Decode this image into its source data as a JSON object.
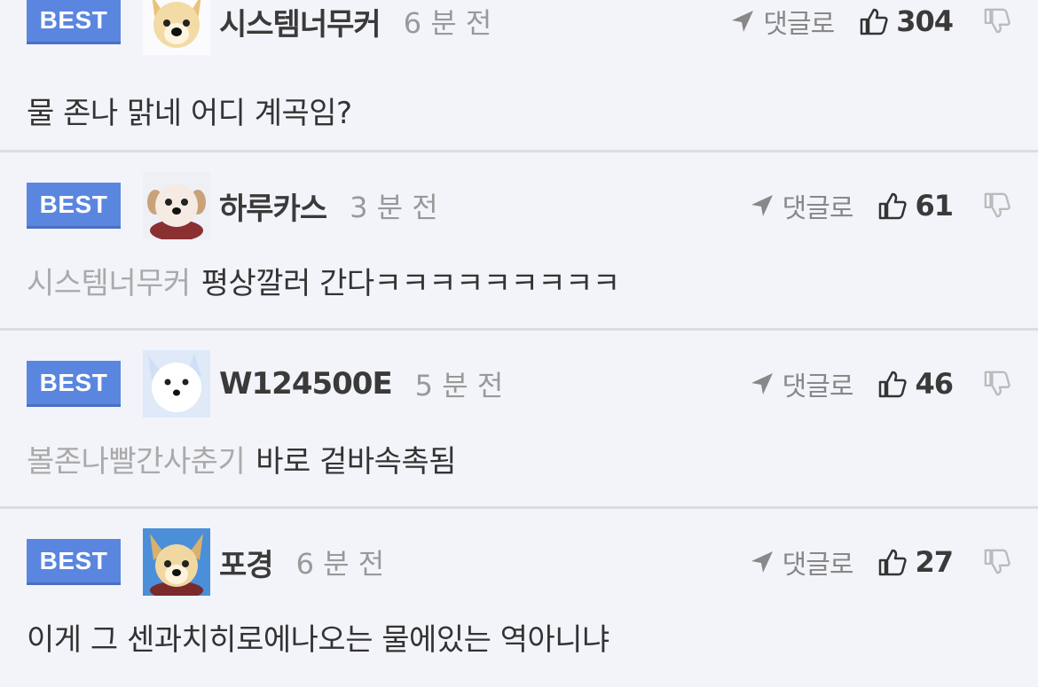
{
  "comments": [
    {
      "badge": "BEST",
      "nickname": "시스템너무커",
      "time": "6 분 전",
      "reply_label": "댓글로",
      "likes": "304",
      "mention": "",
      "text": "물 존나 맑네 어디 계곡임?",
      "avatar": "shiba-face"
    },
    {
      "badge": "BEST",
      "nickname": "하루카스",
      "time": "3 분 전",
      "reply_label": "댓글로",
      "likes": "61",
      "mention": "시스템너무커",
      "text": "평상깔러 간다ㅋㅋㅋㅋㅋㅋㅋㅋㅋ",
      "avatar": "puppy-face"
    },
    {
      "badge": "BEST",
      "nickname": "W124500E",
      "time": "5 분 전",
      "reply_label": "댓글로",
      "likes": "46",
      "mention": "볼존나빨간사춘기",
      "text": "바로 겉바속촉됨",
      "avatar": "white-dog-face"
    },
    {
      "badge": "BEST",
      "nickname": "포경",
      "time": "6 분 전",
      "reply_label": "댓글로",
      "likes": "27",
      "mention": "",
      "text": "이게 그 센과치히로에나오는 물에있는 역아니냐",
      "avatar": "shiba-face-blue"
    }
  ],
  "colors": {
    "best_badge": "#5a86e0",
    "background": "#f3f4f9",
    "mention": "#aaaaaa",
    "time": "#999999"
  }
}
